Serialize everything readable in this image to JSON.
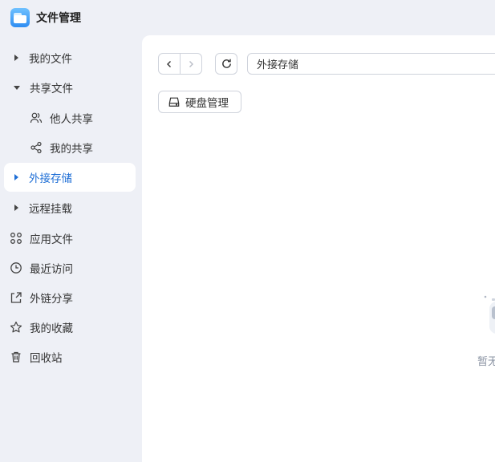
{
  "app": {
    "title": "文件管理"
  },
  "sidebar": {
    "items": [
      {
        "label": "我的文件"
      },
      {
        "label": "共享文件"
      },
      {
        "label": "他人共享"
      },
      {
        "label": "我的共享"
      },
      {
        "label": "外接存储"
      },
      {
        "label": "远程挂载"
      },
      {
        "label": "应用文件"
      },
      {
        "label": "最近访问"
      },
      {
        "label": "外链分享"
      },
      {
        "label": "我的收藏"
      },
      {
        "label": "回收站"
      }
    ],
    "active": "外接存储"
  },
  "toolbar": {
    "path": "外接存储",
    "disk_manage_label": "硬盘管理"
  },
  "content": {
    "empty_text": "暂无"
  },
  "colors": {
    "accent": "#1f6fd6",
    "sidebar_bg": "#eef0f6",
    "main_bg": "#ffffff"
  }
}
